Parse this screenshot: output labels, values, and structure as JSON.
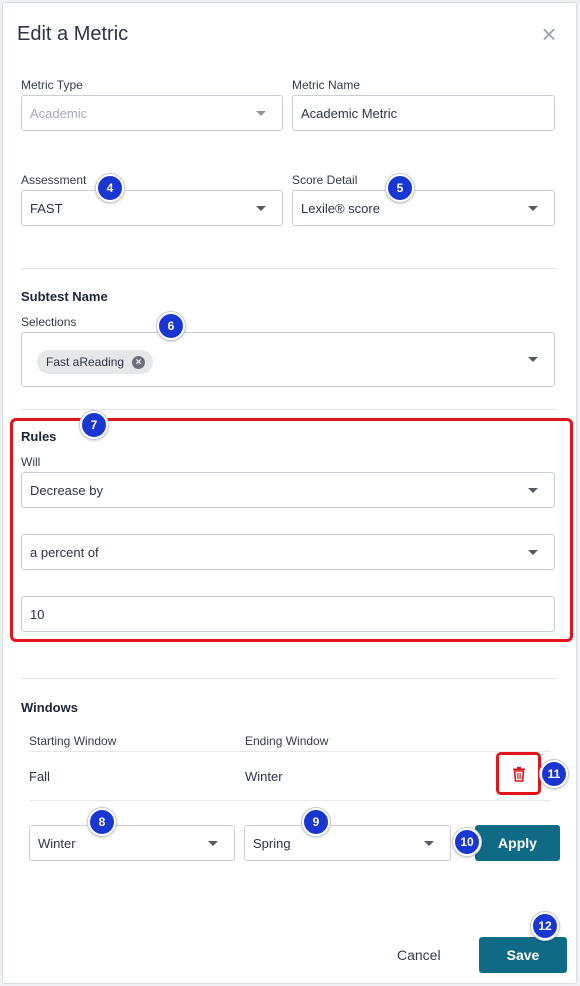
{
  "dialog": {
    "title": "Edit a Metric",
    "close_glyph": "×"
  },
  "metric_type": {
    "label": "Metric Type",
    "value": "Academic"
  },
  "metric_name": {
    "label": "Metric Name",
    "value": "Academic Metric"
  },
  "assessment": {
    "label": "Assessment",
    "value": "FAST"
  },
  "score_detail": {
    "label": "Score Detail",
    "value": "Lexile® score"
  },
  "subtest": {
    "title": "Subtest Name",
    "selections_label": "Selections",
    "chips": [
      "Fast aReading"
    ]
  },
  "rules": {
    "title": "Rules",
    "will_label": "Will",
    "direction": "Decrease by",
    "mode": "a percent of",
    "amount": "10"
  },
  "windows": {
    "title": "Windows",
    "col_start": "Starting Window",
    "col_end": "Ending Window",
    "rows": [
      {
        "start": "Fall",
        "end": "Winter"
      }
    ],
    "new_start": "Winter",
    "new_end": "Spring",
    "apply_label": "Apply"
  },
  "footer": {
    "cancel_label": "Cancel",
    "save_label": "Save"
  },
  "badges": {
    "b4": "4",
    "b5": "5",
    "b6": "6",
    "b7": "7",
    "b8": "8",
    "b9": "9",
    "b10": "10",
    "b11": "11",
    "b12": "12"
  },
  "colors": {
    "primary": "#0f6a86",
    "highlight": "#e2131a",
    "badge": "#1a36d0",
    "trash": "#e2131a"
  },
  "icons": {
    "close": "close-icon",
    "caret": "chevron-down-icon",
    "chip_remove": "remove-chip-icon",
    "delete": "trash-icon"
  }
}
